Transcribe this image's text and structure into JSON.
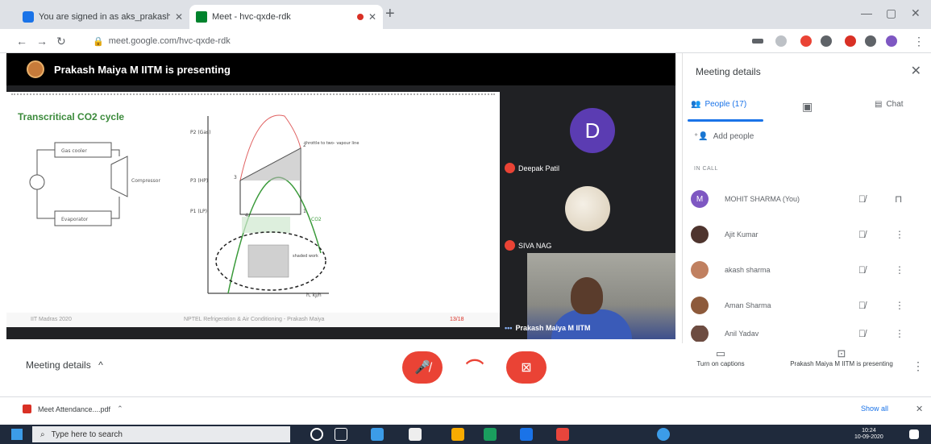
{
  "browser": {
    "tabs": [
      {
        "title": "You are signed in as aks_prakash",
        "active": false
      },
      {
        "title": "Meet - hvc-qxde-rdk",
        "active": true
      }
    ],
    "url": "meet.google.com/hvc-qxde-rdk"
  },
  "meet": {
    "presenting_banner": "Prakash Maiya M IITM is presenting",
    "slide": {
      "title": "Transcritical CO2 cycle",
      "labels": [
        "Gas cooler",
        "Compressor",
        "Evaporator",
        "P2 (Gas)",
        "P3 (HP)",
        "P1 (LP)",
        "h, kJ/h",
        "throttle to two- vapour line",
        "shaded work",
        "CO2",
        "2",
        "3",
        "1",
        "4"
      ],
      "footer_left": "IIT Madras 2020",
      "footer_center": "NPTEL Refrigeration & Air Conditioning - Prakash Maiya",
      "footer_right": "13/18"
    },
    "participants_tiles": [
      {
        "initial": "D",
        "name": "Deepak Patil",
        "muted": true
      },
      {
        "name": "SIVA NAG",
        "muted": true
      },
      {
        "name": "Prakash Maiya M IITM",
        "muted": false
      }
    ]
  },
  "panel": {
    "title": "Meeting details",
    "tabs": [
      {
        "label": "People (17)",
        "active": true
      },
      {
        "label": "",
        "icon": "chat-bubble-icon"
      },
      {
        "label": "Chat",
        "active": false
      }
    ],
    "add_people": "Add people",
    "section_label": "IN CALL",
    "people": [
      {
        "initial": "M",
        "name": "MOHIT SHARMA (You)",
        "color": "#7e57c2"
      },
      {
        "name": "Ajit Kumar",
        "color": "#4e342e"
      },
      {
        "name": "akash sharma",
        "color": "#c08060"
      },
      {
        "name": "Aman Sharma",
        "color": "#8d5a3b"
      },
      {
        "name": "Anil Yadav",
        "color": "#6d4c41"
      }
    ]
  },
  "bottom": {
    "meeting_details": "Meeting details",
    "chevron": "^",
    "captions": "Turn on captions",
    "presenting": "Prakash Maiya M IITM is presenting"
  },
  "downloads": {
    "file": "Meet Attendance....pdf",
    "show_all": "Show all"
  },
  "taskbar": {
    "search_placeholder": "Type here to search",
    "time": "10:24",
    "date": "10-09-2020"
  },
  "colors": {
    "red": "#ea4335",
    "blue": "#1a73e8",
    "stage": "#202124"
  }
}
